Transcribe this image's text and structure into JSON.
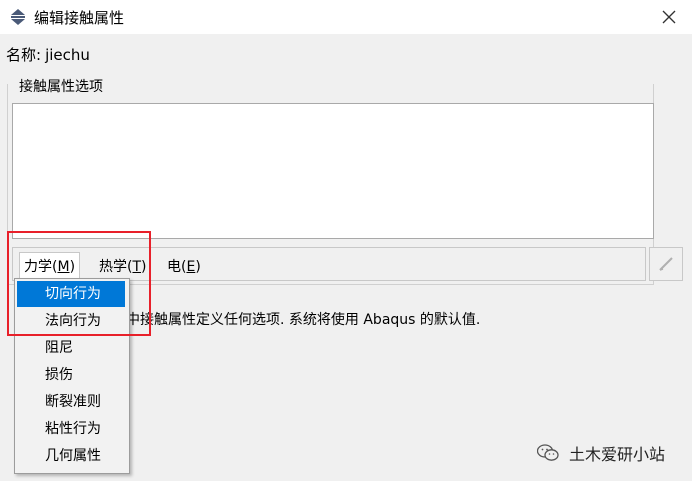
{
  "window": {
    "title": "编辑接触属性"
  },
  "name_row": {
    "label": "名称:",
    "value": "jiechu"
  },
  "group": {
    "label": "接触属性选项"
  },
  "menubar": {
    "items": [
      {
        "text": "力学(",
        "mnemonic": "M",
        "close": ")"
      },
      {
        "text": "热学(",
        "mnemonic": "T",
        "close": ")"
      },
      {
        "text": "电(",
        "mnemonic": "E",
        "close": ")"
      }
    ]
  },
  "dropdown": {
    "items": [
      "切向行为",
      "法向行为",
      "阻尼",
      "损伤",
      "断裂准则",
      "粘性行为",
      "几何属性"
    ],
    "selected_index": 0
  },
  "hint": {
    "text": "中接触属性定义任何选项. 系统将使用 Abaqus 的默认值."
  },
  "watermark": {
    "text": "土木爱研小站"
  },
  "colors": {
    "selection": "#0078d7",
    "highlight_box": "#e8202a"
  }
}
